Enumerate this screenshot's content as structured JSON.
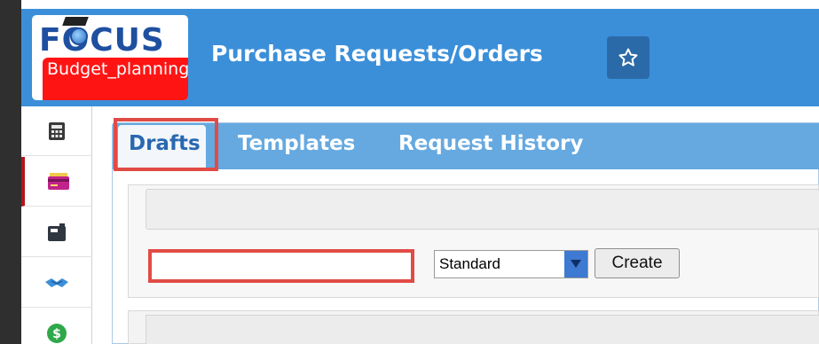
{
  "header": {
    "logo_text": "FOCUS",
    "badge_label": "Budget_planning",
    "title": "Purchase Requests/Orders",
    "star_icon": "star-icon"
  },
  "sidebar": {
    "items": [
      {
        "icon": "calculator-icon"
      },
      {
        "icon": "credit-card-icon",
        "active": true
      },
      {
        "icon": "cash-register-icon"
      },
      {
        "icon": "handshake-icon"
      },
      {
        "icon": "dollar-coin-icon"
      }
    ]
  },
  "tabs": [
    {
      "label": "Drafts",
      "active": true
    },
    {
      "label": "Templates"
    },
    {
      "label": "Request History"
    }
  ],
  "form": {
    "name_input_value": "",
    "type_select_value": "Standard",
    "create_label": "Create"
  },
  "colors": {
    "header_bg": "#3b8fd9",
    "tab_bar_bg": "#65a9e0",
    "highlight": "#e14b45",
    "badge_red": "#ff1414"
  }
}
